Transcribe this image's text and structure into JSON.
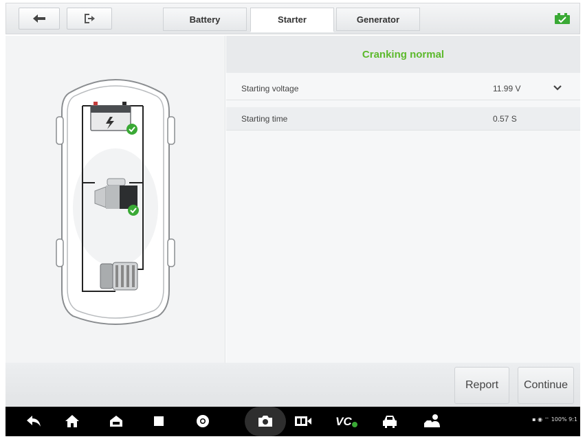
{
  "tabs": [
    {
      "label": "Battery",
      "selected": false
    },
    {
      "label": "Starter",
      "selected": true
    },
    {
      "label": "Generator",
      "selected": false
    }
  ],
  "result": {
    "status_text": "Cranking normal",
    "status_color": "#5cb92c"
  },
  "rows": [
    {
      "label": "Starting voltage",
      "value": "11.99 V",
      "expandable": true
    },
    {
      "label": "Starting time",
      "value": "0.57 S",
      "expandable": false
    }
  ],
  "buttons": {
    "report": "Report",
    "continue": "Continue"
  },
  "icons": {
    "toolbar": [
      "back-arrow-icon",
      "exit-icon",
      "battery-status-icon"
    ],
    "diagram": [
      "car-outline",
      "battery-icon",
      "starter-motor-icon",
      "generator-icon",
      "check-badge-icon"
    ],
    "navbar": [
      "back-icon",
      "home-icon",
      "car-home-icon",
      "recent-apps-icon",
      "chrome-icon",
      "camera-icon",
      "screen-record-icon",
      "vci-icon",
      "car-icon",
      "technician-icon"
    ]
  },
  "status_bar": {
    "text": "100% 9:1"
  },
  "colors": {
    "accent_green": "#5cb92c",
    "battery_icon": "#3aa935"
  }
}
